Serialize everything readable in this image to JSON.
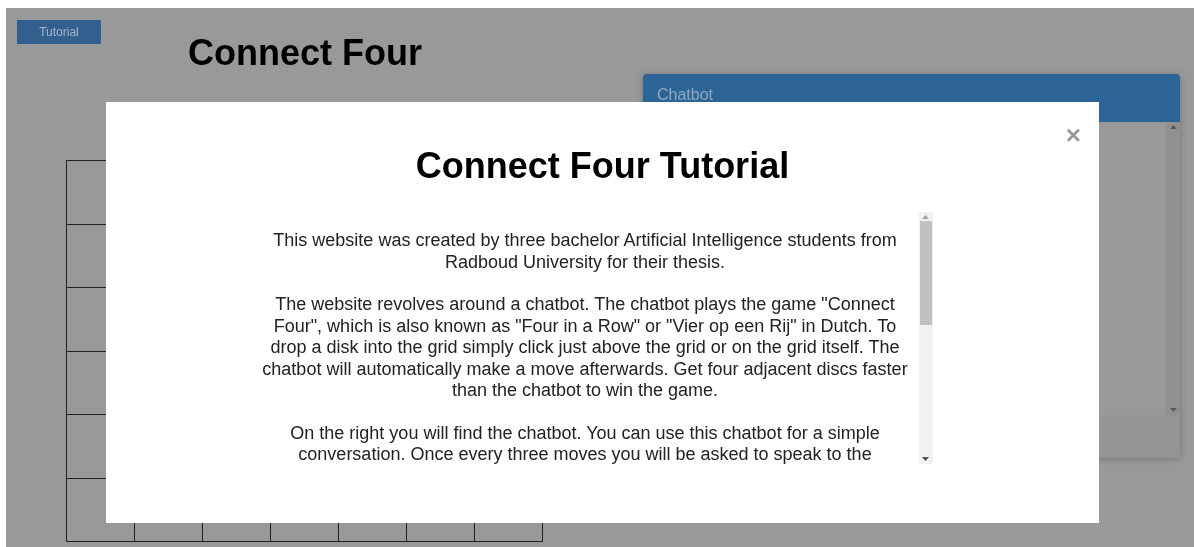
{
  "page": {
    "tutorial_button": "Tutorial",
    "title": "Connect Four"
  },
  "chatbot": {
    "title": "Chatbot"
  },
  "modal": {
    "title": "Connect Four Tutorial",
    "close": "×",
    "paragraphs": [
      "This website was created by three bachelor Artificial Intelligence students from Radboud University for their thesis.",
      "The website revolves around a chatbot. The chatbot plays the game \"Connect Four\", which is also known as \"Four in a Row\" or \"Vier op een Rij\" in Dutch. To drop a disk into the grid simply click just above the grid or on the grid itself. The chatbot will automatically make a move afterwards. Get four adjacent discs faster than the chatbot to win the game.",
      "On the right you will find the chatbot. You can use this chatbot for a simple conversation. Once every three moves you will be asked to speak to the"
    ]
  }
}
